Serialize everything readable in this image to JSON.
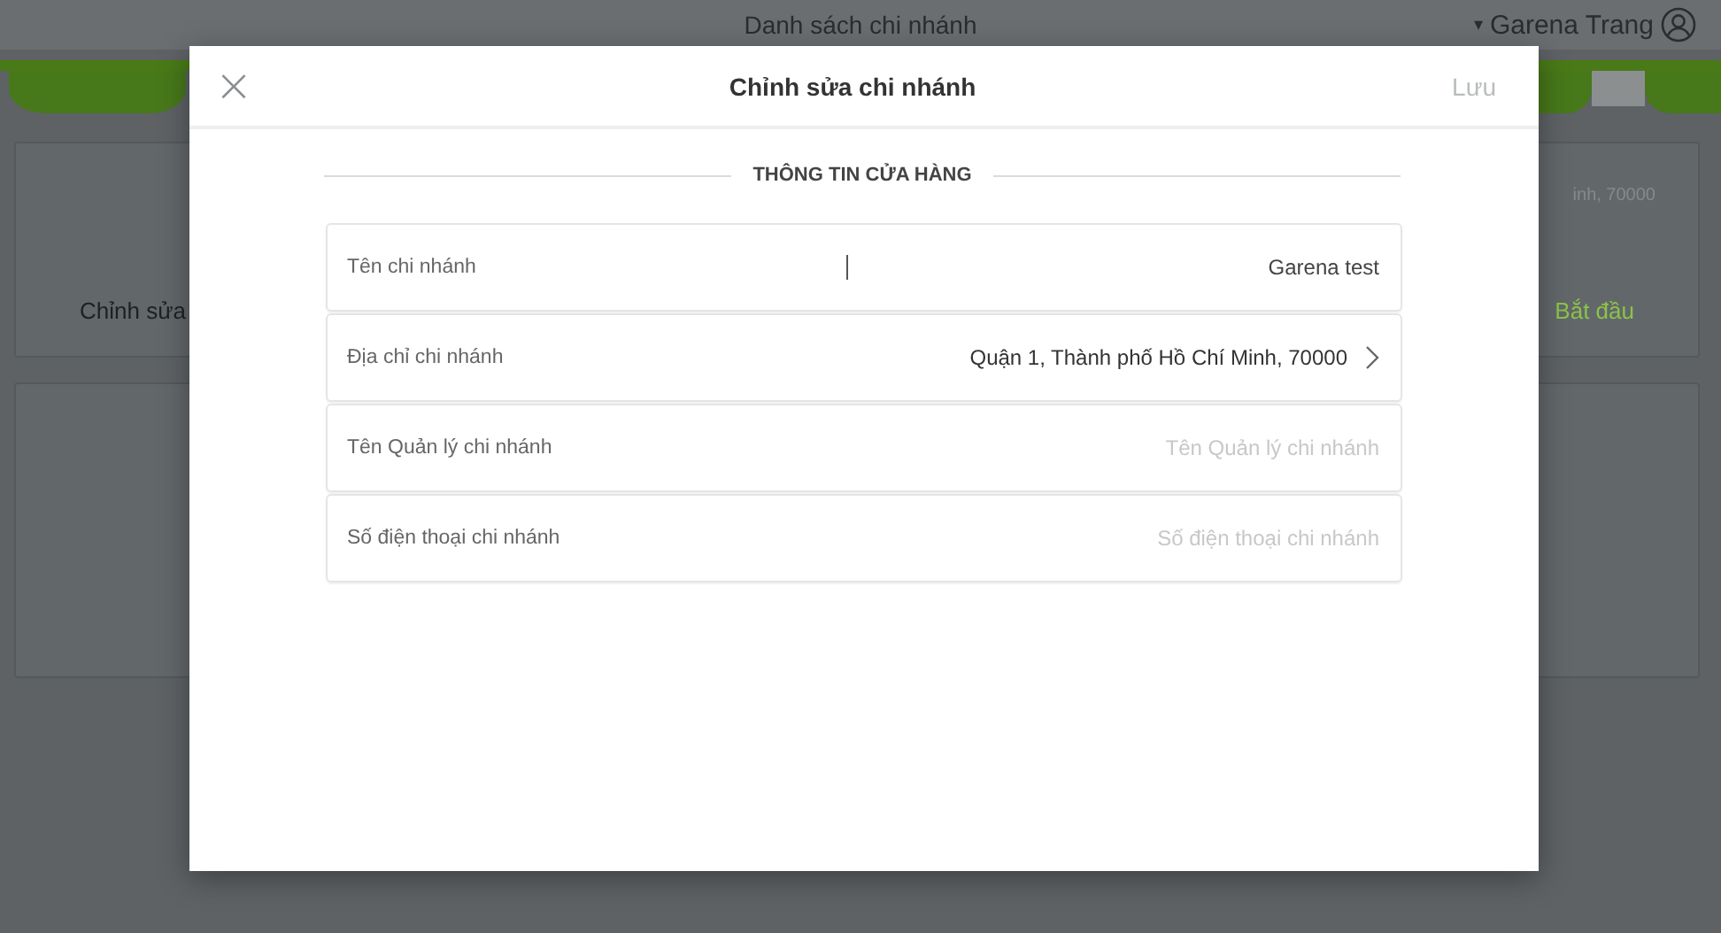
{
  "page": {
    "title": "Danh sách chi nhánh",
    "user": "Garena Trang",
    "user_caret": "▾",
    "card": {
      "address": "inh, 70000",
      "edit_label": "Chỉnh sửa",
      "start_label": "Bắt đầu"
    }
  },
  "dialog": {
    "title": "Chỉnh sửa chi nhánh",
    "close": "×",
    "save": {
      "label": "Lưu",
      "disabled": true
    },
    "section": "THÔNG TIN CỬA HÀNG",
    "fields": [
      {
        "kind": "input",
        "label": "Tên chi nhánh",
        "value": "Garena test",
        "focused": true
      },
      {
        "kind": "select",
        "label": "Địa chỉ chi nhánh",
        "value": "Quận 1, Thành phố Hồ Chí Minh, 70000"
      },
      {
        "kind": "input",
        "label": "Tên Quản lý chi nhánh",
        "placeholder": "Tên Quản lý chi nhánh",
        "focused": false
      },
      {
        "kind": "input",
        "label": "Số điện thoại chi nhánh",
        "placeholder": "Số điện thoại chi nhánh",
        "focused": false
      }
    ]
  }
}
